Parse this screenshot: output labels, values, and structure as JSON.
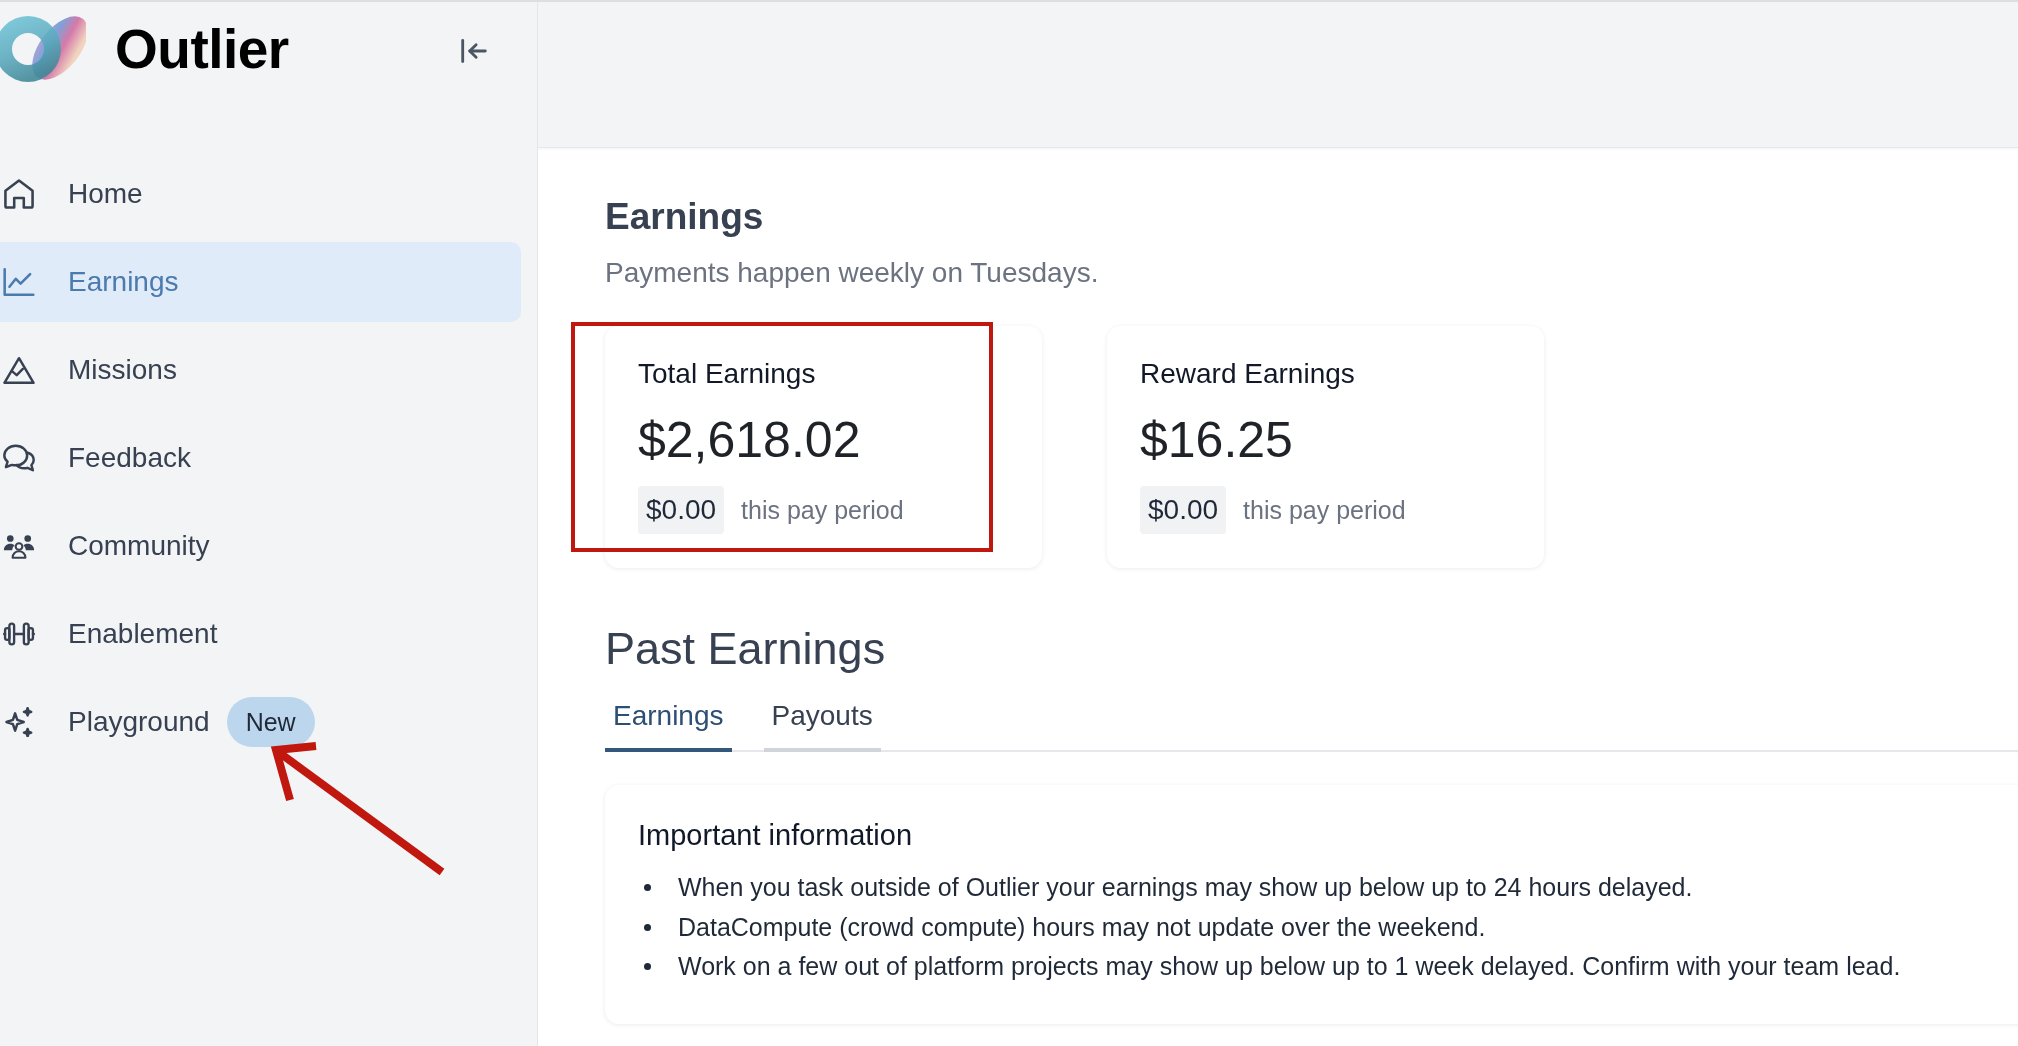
{
  "sidebar": {
    "brand": "Outlier",
    "nav_items": [
      {
        "label": "Home",
        "selected": false,
        "annotation_arrow": false
      },
      {
        "label": "Earnings",
        "selected": true,
        "annotation_arrow": false
      },
      {
        "label": "Missions",
        "selected": false,
        "annotation_arrow": false
      },
      {
        "label": "Feedback",
        "selected": false,
        "annotation_arrow": false
      },
      {
        "label": "Community",
        "selected": false,
        "annotation_arrow": false
      },
      {
        "label": "Enablement",
        "selected": false,
        "annotation_arrow": false
      },
      {
        "label": "Playground",
        "selected": false,
        "badge": "New",
        "annotation_arrow": true
      }
    ]
  },
  "page": {
    "title": "Earnings",
    "subtitle": "Payments happen weekly on Tuesdays."
  },
  "summary_cards": [
    {
      "title": "Total Earnings",
      "amount": "$2,618.02",
      "period_amount": "$0.00",
      "period_label": "this pay period",
      "annotation_box": true
    },
    {
      "title": "Reward Earnings",
      "amount": "$16.25",
      "period_amount": "$0.00",
      "period_label": "this pay period",
      "annotation_box": false
    }
  ],
  "past_earnings": {
    "title": "Past Earnings",
    "tabs": [
      {
        "label": "Earnings",
        "selected": true
      },
      {
        "label": "Payouts",
        "selected": false
      }
    ],
    "info": {
      "title": "Important information",
      "items": [
        "When you task outside of Outlier your earnings may show up below up to 24 hours delayed.",
        "DataCompute (crowd compute) hours may not update over the weekend.",
        "Work on a few out of platform projects may show up below up to 1 week delayed. Confirm with your team lead."
      ]
    }
  }
}
